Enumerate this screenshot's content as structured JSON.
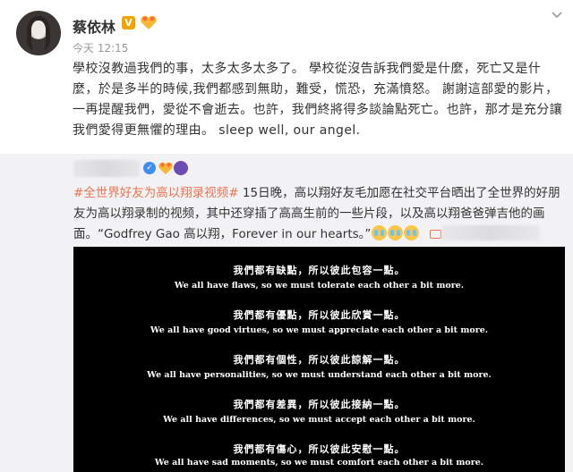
{
  "post": {
    "author": "蔡依林",
    "verified_mark": "V",
    "timestamp": "今天 12:15",
    "text": "學校沒教過我們的事，太多太多太多了。 學校從沒告訴我們愛是什麼，死亡又是什麼，於是多半的時候,我們都感到無助，難受，慌恐，充滿憤怒。 謝謝這部愛的影片，一再提醒我們，愛從不會逝去。也許，我們終將得多談論點死亡。也許，那才是充分讓我們愛得更無懼的理由。 sleep well, our angel."
  },
  "repost": {
    "topic": "#全世界好友为高以翔录视频#",
    "text": " 15日晚，高以翔好友毛加愿在社交平台晒出了全世界的好朋友为高以翔录制的视频，其中还穿插了高高生前的一些片段，以及高以翔爸爸弹吉他的画面。“Godfrey Gao 高以翔，Forever in our hearts。”",
    "video_lines": [
      {
        "zh": "我們都有缺點，所以彼此包容一點。",
        "en": "We all have flaws, so we must tolerate each other a bit more."
      },
      {
        "zh": "我們都有優點，所以彼此欣賞一點。",
        "en": "We all have good virtues, so we must appreciate each other a bit more."
      },
      {
        "zh": "我們都有個性，所以彼此諒解一點。",
        "en": "We all have personalities, so we must understand each other a bit more."
      },
      {
        "zh": "我們都有差異，所以彼此接納一點。",
        "en": "We all have differences, so we must accept each other a bit more."
      },
      {
        "zh": "我們都有傷心，所以彼此安慰一點。",
        "en": "We all have sad moments, so we must comfort each other a bit more."
      }
    ]
  },
  "icons": {
    "more": "chevron-down-icon",
    "verified": "verified-badge-icon",
    "vip": "vip-heart-icon",
    "emoji": "crying-emoji-icon",
    "link": "video-link-icon"
  },
  "colors": {
    "topic": "#eb7350",
    "verified": "#f0a400",
    "repost_bg": "#f2f2f5",
    "video_bg": "#000000"
  }
}
